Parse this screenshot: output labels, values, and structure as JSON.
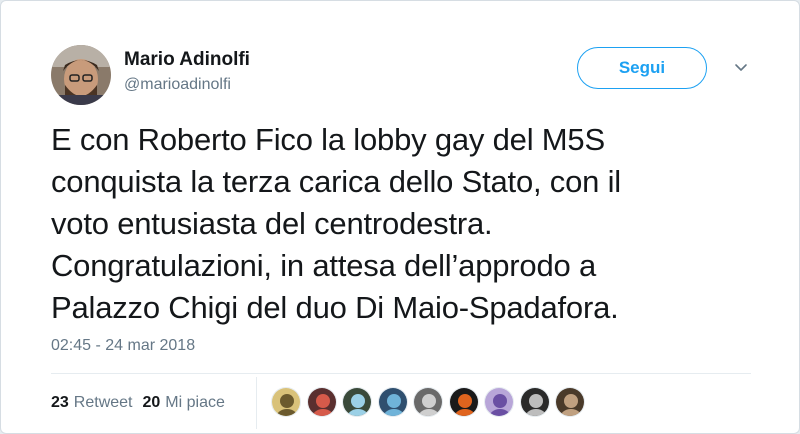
{
  "author": {
    "name": "Mario Adinolfi",
    "handle": "@marioadinolfi"
  },
  "follow_button": {
    "label": "Segui"
  },
  "tweet": {
    "lines": [
      "E con Roberto Fico la lobby gay del M5S",
      "conquista la terza carica dello Stato, con il",
      "voto entusiasta del centrodestra.",
      "Congratulazioni, in attesa dell’approdo a",
      "Palazzo Chigi del duo Di Maio-Spadafora."
    ],
    "timestamp": "02:45 - 24 mar 2018"
  },
  "stats": {
    "retweets": {
      "count": "23",
      "label": "Retweet"
    },
    "likes": {
      "count": "20",
      "label": "Mi piace"
    }
  },
  "colors": {
    "accent": "#1da1f2",
    "text": "#14171a",
    "secondary": "#657786",
    "border": "#e6ecf0"
  },
  "liker_avatars": [
    {
      "bg": "#d9c27a",
      "fg": "#6b5a2e"
    },
    {
      "bg": "#5a2f2f",
      "fg": "#d65a4a"
    },
    {
      "bg": "#3a4a3a",
      "fg": "#9bd0e6"
    },
    {
      "bg": "#2f4f6f",
      "fg": "#6fb3d9"
    },
    {
      "bg": "#6a6a6a",
      "fg": "#cfcfcf"
    },
    {
      "bg": "#1a1a1a",
      "fg": "#e0641e"
    },
    {
      "bg": "#b8a6d8",
      "fg": "#6a4fa3"
    },
    {
      "bg": "#2a2a2a",
      "fg": "#bdbdbd"
    },
    {
      "bg": "#4a3a2a",
      "fg": "#c0a080"
    }
  ]
}
